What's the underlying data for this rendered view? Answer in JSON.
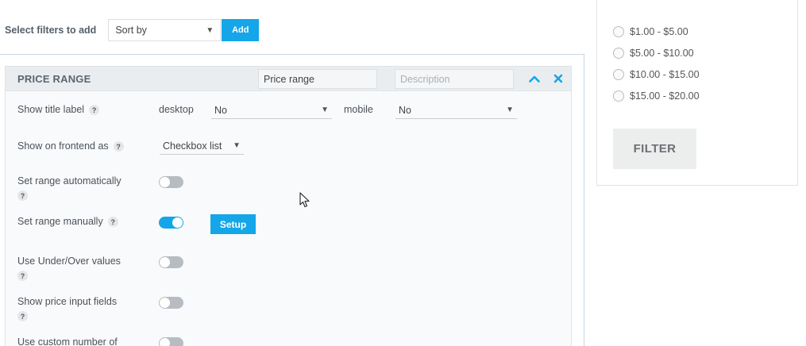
{
  "topbar": {
    "label": "Select filters to add",
    "sort_value": "Sort by",
    "add_label": "Add"
  },
  "panel": {
    "title": "PRICE RANGE",
    "title_input_value": "Price range",
    "description_placeholder": "Description",
    "rows": {
      "show_title_label": "Show title label",
      "desktop_label": "desktop",
      "desktop_value": "No",
      "mobile_label": "mobile",
      "mobile_value": "No",
      "show_on_frontend": "Show on frontend as",
      "frontend_value": "Checkbox list",
      "set_range_auto": "Set range automatically",
      "set_range_manual": "Set range manually",
      "setup_label": "Setup",
      "under_over": "Use Under/Over values",
      "price_inputs": "Show price input fields",
      "custom_number": "Use custom number of"
    },
    "help_glyph": "?",
    "toggles": {
      "set_range_auto": false,
      "set_range_manual": true,
      "under_over": false,
      "price_inputs": false,
      "custom_number": false
    }
  },
  "widget": {
    "options": [
      "$1.00 - $5.00",
      "$5.00 - $10.00",
      "$10.00 - $15.00",
      "$15.00 - $20.00"
    ],
    "filter_label": "FILTER"
  },
  "colors": {
    "accent": "#14a6e8",
    "toggle_off": "#b6bcc2"
  }
}
